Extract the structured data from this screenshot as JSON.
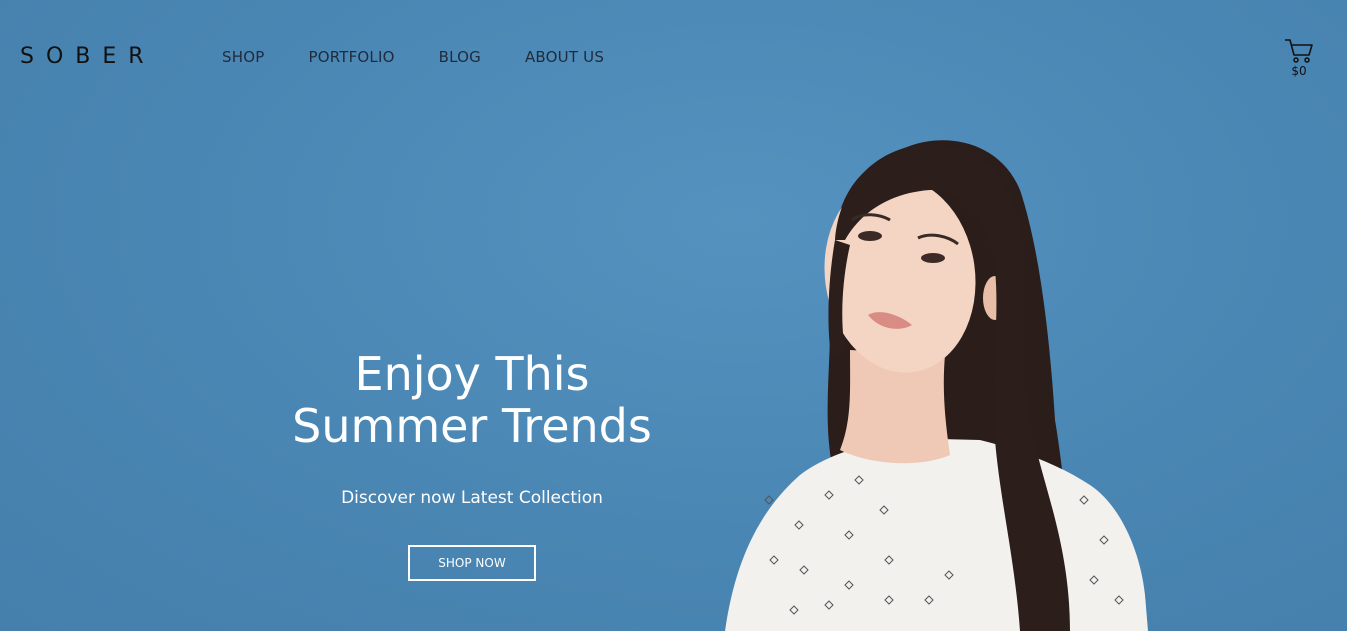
{
  "header": {
    "logo": "SOBER",
    "nav": [
      "SHOP",
      "PORTFOLIO",
      "BLOG",
      "ABOUT US"
    ],
    "cart_total": "$0"
  },
  "hero": {
    "title_line1": "Enjoy This",
    "title_line2": "Summer Trends",
    "subtitle": "Discover now Latest Collection",
    "cta_label": "SHOP NOW"
  },
  "colors": {
    "background": "#4d87b3",
    "text_light": "#ffffff",
    "text_dark": "#1f2b3a"
  },
  "icons": {
    "cart": "shopping-cart-icon"
  }
}
